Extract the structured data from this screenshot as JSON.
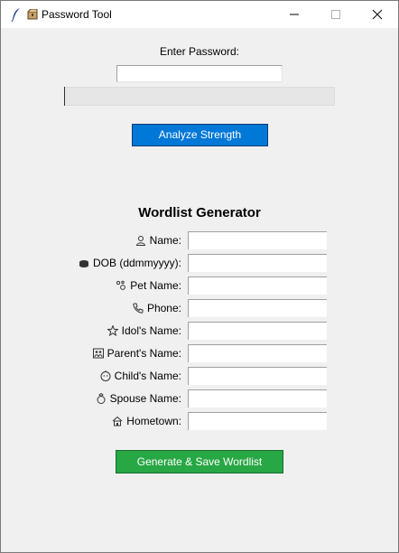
{
  "window": {
    "title": "Password Tool",
    "title_icon": "feather-icon",
    "app_icon": "package-icon",
    "controls": [
      "minimize-icon",
      "maximize-icon",
      "close-icon"
    ]
  },
  "password": {
    "label": "Enter Password:",
    "value": "",
    "strength_progress": 0,
    "analyze_label": "Analyze Strength"
  },
  "wordlist": {
    "title": "Wordlist Generator",
    "fields": [
      {
        "icon": "person-icon",
        "label": "Name:",
        "value": ""
      },
      {
        "icon": "cake-icon",
        "label": "DOB (ddmmyyyy):",
        "value": ""
      },
      {
        "icon": "paw-icon",
        "label": "Pet Name:",
        "value": ""
      },
      {
        "icon": "phone-icon",
        "label": "Phone:",
        "value": ""
      },
      {
        "icon": "star-icon",
        "label": "Idol's Name:",
        "value": ""
      },
      {
        "icon": "family-icon",
        "label": "Parent's Name:",
        "value": ""
      },
      {
        "icon": "baby-icon",
        "label": "Child's Name:",
        "value": ""
      },
      {
        "icon": "ring-icon",
        "label": "Spouse Name:",
        "value": ""
      },
      {
        "icon": "house-icon",
        "label": "Hometown:",
        "value": ""
      }
    ],
    "generate_label": "Generate & Save Wordlist"
  },
  "colors": {
    "analyze_button": "#0078d7",
    "generate_button": "#28a745",
    "window_bg": "#f0f0f0"
  }
}
